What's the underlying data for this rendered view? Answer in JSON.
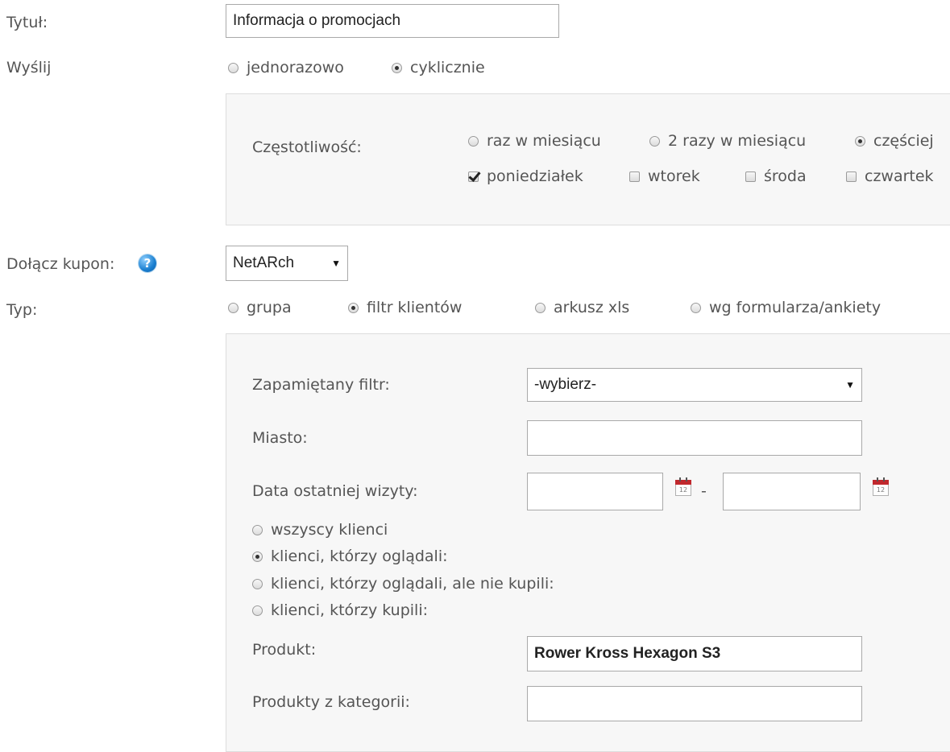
{
  "form": {
    "title": {
      "label": "Tytuł:",
      "value": "Informacja o promocjach"
    },
    "send": {
      "label": "Wyślij",
      "options": [
        {
          "label": "jednorazowo",
          "selected": false
        },
        {
          "label": "cyklicznie",
          "selected": true
        }
      ]
    },
    "frequency": {
      "label": "Częstotliwość:",
      "options": [
        {
          "label": "raz w miesiącu",
          "selected": false
        },
        {
          "label": "2 razy w miesiącu",
          "selected": false
        },
        {
          "label": "częściej",
          "selected": true
        }
      ],
      "days": [
        {
          "label": "poniedziałek",
          "checked": true
        },
        {
          "label": "wtorek",
          "checked": false
        },
        {
          "label": "środa",
          "checked": false
        },
        {
          "label": "czwartek",
          "checked": false
        }
      ]
    },
    "coupon": {
      "label": "Dołącz kupon:",
      "help_icon_glyph": "?",
      "selected": "NetARch"
    },
    "type": {
      "label": "Typ:",
      "options": [
        {
          "label": "grupa",
          "selected": false
        },
        {
          "label": "filtr klientów",
          "selected": true
        },
        {
          "label": "arkusz xls",
          "selected": false
        },
        {
          "label": "wg formularza/ankiety",
          "selected": false
        }
      ]
    },
    "filter": {
      "saved_filter": {
        "label": "Zapamiętany filtr:",
        "selected": "-wybierz-"
      },
      "city": {
        "label": "Miasto:",
        "value": ""
      },
      "last_visit": {
        "label": "Data ostatniej wizyty:",
        "from": "",
        "to": "",
        "separator": "-",
        "calendar_day": "12"
      },
      "clients": [
        {
          "label": "wszyscy klienci",
          "selected": false
        },
        {
          "label": "klienci, którzy oglądali:",
          "selected": true
        },
        {
          "label": "klienci, którzy oglądali, ale nie kupili:",
          "selected": false
        },
        {
          "label": "klienci, którzy kupili:",
          "selected": false
        }
      ],
      "product": {
        "label": "Produkt:",
        "value": "Rower Kross Hexagon S3"
      },
      "category_products": {
        "label": "Produkty z kategorii:",
        "value": ""
      }
    }
  },
  "icons": {
    "select_arrow": "▼"
  },
  "colors": {
    "panel_bg": "#f7f7f7",
    "panel_border": "#dddddd",
    "help_icon": "#1a7fd0",
    "calendar_accent": "#c0282d"
  }
}
